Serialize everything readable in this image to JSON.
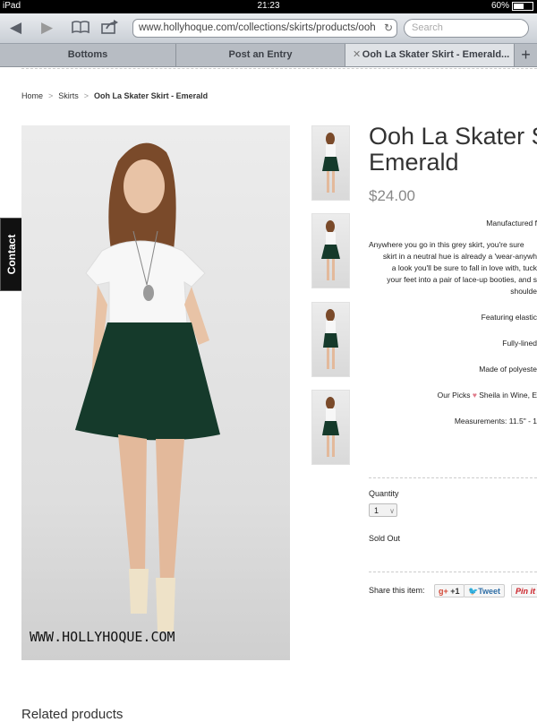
{
  "status": {
    "device": "iPad",
    "time": "21:23",
    "battery": "60%"
  },
  "browser": {
    "url": "www.hollyhoque.com/collections/skirts/products/ooh",
    "search_placeholder": "Search",
    "tabs": [
      {
        "label": "Bottoms"
      },
      {
        "label": "Post an Entry"
      },
      {
        "label": "Ooh La Skater Skirt - Emerald..."
      }
    ],
    "new_tab": "+"
  },
  "breadcrumb": {
    "home": "Home",
    "sep": ">",
    "category": "Skirts",
    "current": "Ooh La Skater Skirt - Emerald"
  },
  "contact_tab": "Contact",
  "product": {
    "title_line1": "Ooh La Skater S",
    "title_line2": "Emerald",
    "price": "$24.00",
    "desc": [
      "Manufactured f",
      "Anywhere you go in this grey skirt, you're sure",
      "skirt in a neutral hue is already a 'wear-anywh",
      "a look you'll be sure to fall in love with, tuck",
      "your feet into a pair of lace-up booties, and s",
      "shoulde",
      "Featuring elastic",
      "Fully-lined",
      "Made of polyeste",
      "Our Picks",
      "Sheila in Wine, E",
      "Measurements: 11.5\" - 1"
    ],
    "quantity_label": "Quantity",
    "quantity_value": "1",
    "sold_out": "Sold Out",
    "share_label": "Share this item:",
    "gplus": "+1",
    "tweet": "Tweet",
    "pinit": "Pin it",
    "watermark": "WWW.HOLLYHOQUE.COM"
  },
  "related_heading": "Related products"
}
